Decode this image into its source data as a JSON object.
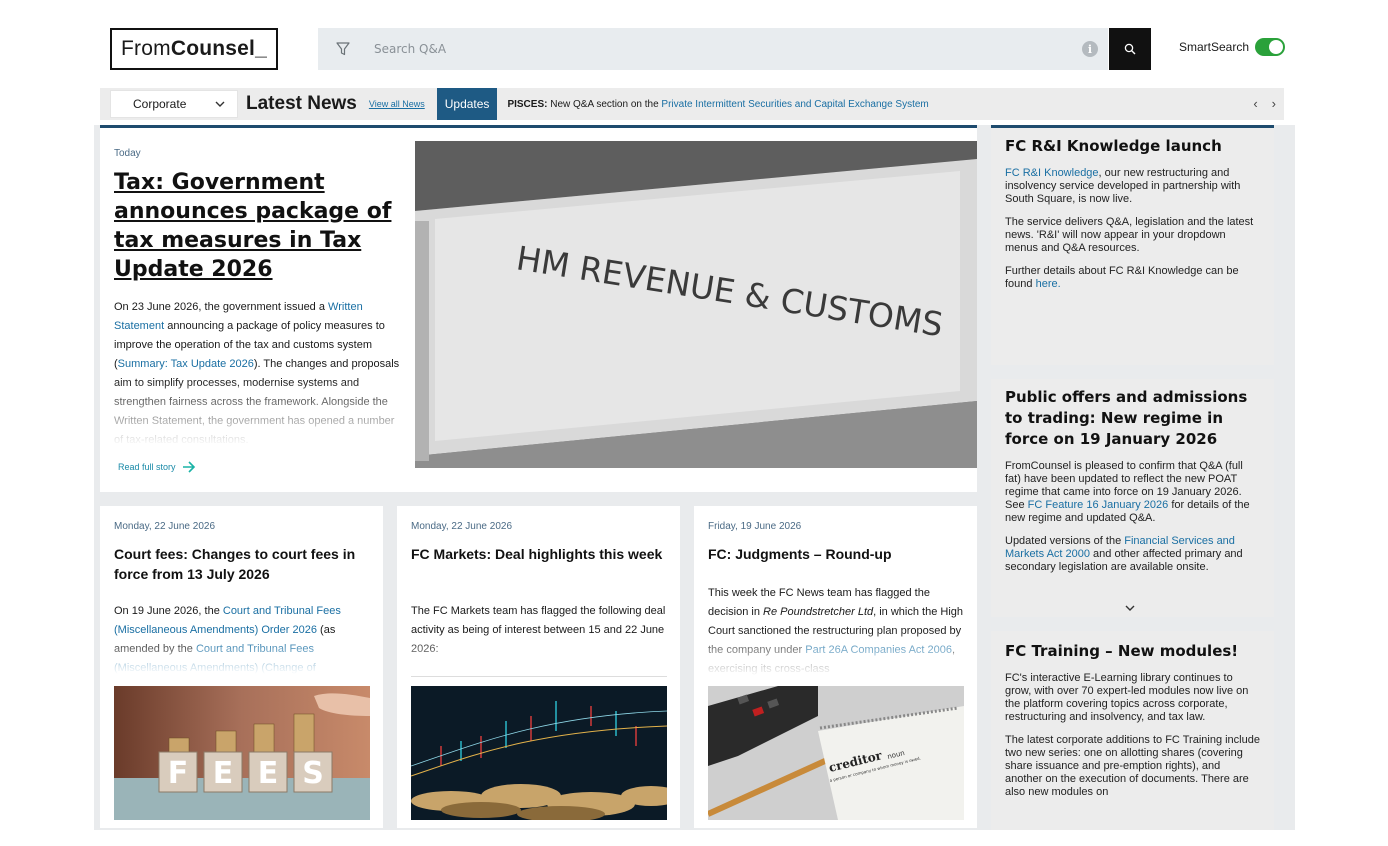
{
  "header": {
    "logo_light": "From",
    "logo_bold": "Counsel_",
    "search_placeholder": "Search Q&A",
    "smartsearch_label": "SmartSearch"
  },
  "news_strip": {
    "practice_area": "Corporate",
    "heading": "Latest News",
    "view_all": "View all News",
    "updates_label": "Updates",
    "ticker_bold": "PISCES:",
    "ticker_text": " New Q&A section on the ",
    "ticker_link": "Private Intermittent Securities and Capital Exchange System"
  },
  "feature": {
    "date": "Today",
    "title": "Tax: Government announces package of tax measures in Tax Update 2026",
    "body_1": "On 23 June 2026, the government issued a ",
    "link_1": "Written Statement",
    "body_2": " announcing a package of policy measures to improve the operation of the tax and customs system (",
    "link_2": "Summary: Tax Update 2026",
    "body_3": "). The changes and proposals aim to simplify processes, modernise systems and strengthen fairness across the framework. Alongside the Written Statement, the government has opened a number of tax-related consultations.",
    "read_more": "Read full story",
    "image_text": "HM REVENUE & CUSTOMS"
  },
  "cards": [
    {
      "date": "Monday, 22 June 2026",
      "title": "Court fees: Changes to court fees in force from 13 July 2026",
      "body_1": "On 19 June 2026, the ",
      "link_1": "Court and Tribunal Fees (Miscellaneous Amendments) Order 2026",
      "body_2": " (as amended by the ",
      "link_2": "Court and Tribunal Fees (Miscellaneous Amendments) (Change of",
      "image_text": "FEES"
    },
    {
      "date": "Monday, 22 June 2026",
      "title": "FC Markets: Deal highlights this week",
      "body_1": "The FC Markets team has flagged the following deal activity as being of interest between 15 and 22 June 2026:"
    },
    {
      "date": "Friday, 19 June 2026",
      "title": "FC: Judgments – Round-up",
      "body_1": "This week the FC News team has flagged the decision in ",
      "body_italic": "Re Poundstretcher Ltd",
      "body_2": ", in which the High Court sanctioned the restructuring plan proposed by the company under ",
      "link_1": "Part 26A Companies Act 2006",
      "body_3": ", exercising its cross-class",
      "image_word": "creditor",
      "image_pos": "noun",
      "image_def": "a person or company to whom money is owed."
    }
  ],
  "sidebar": [
    {
      "title": "FC R&I Knowledge launch",
      "p1_link": "FC R&I Knowledge",
      "p1": ", our new restructuring and insolvency service developed in partnership with South Square, is now live.",
      "p2": "The service delivers Q&A, legislation and the latest news. 'R&I' will now appear in your dropdown menus and Q&A resources.",
      "p3": "Further details about FC R&I Knowledge can be found ",
      "p3_link": "here."
    },
    {
      "title": "Public offers and admissions to trading: New regime in force on 19 January 2026",
      "p1": "FromCounsel is pleased to confirm that Q&A (full fat) have been updated to reflect the new POAT regime that came into force on 19 January 2026. See ",
      "p1_link": "FC Feature 16 January 2026",
      "p1_end": " for details of the new regime and updated Q&A.",
      "p2": "Updated versions of the ",
      "p2_link": "Financial Services and Markets Act 2000",
      "p2_end": " and other affected primary and secondary legislation are available onsite."
    },
    {
      "title": "FC Training – New modules!",
      "p1": "FC's interactive E-Learning library continues to grow, with over 70 expert-led modules now live on the platform covering topics across corporate, restructuring and insolvency, and tax law.",
      "p2": "The latest corporate additions to FC Training include two new series: one on allotting shares (covering share issuance and pre-emption rights), and another on the execution of documents. There are also new modules on"
    }
  ],
  "colors": {
    "accent_navy": "#1e4b6e",
    "updates_bg": "#1e5a84",
    "link": "#1a6fa3",
    "toggle_on": "#2aa13a"
  }
}
